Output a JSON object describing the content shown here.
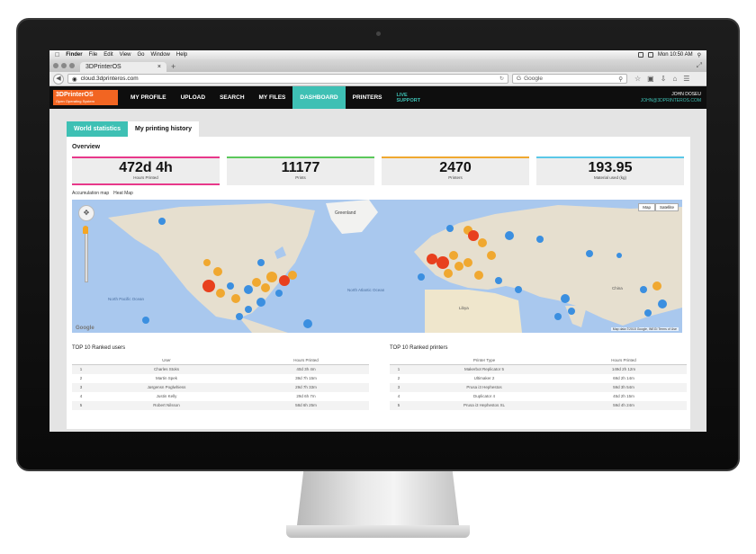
{
  "mac_menubar": {
    "items": [
      "Finder",
      "File",
      "Edit",
      "View",
      "Go",
      "Window",
      "Help"
    ],
    "clock": "Mon 10:50 AM"
  },
  "browser": {
    "tab_title": "3DPrinterOS",
    "url": "cloud.3dprinteros.com",
    "search_placeholder": "Google",
    "search_engine": "G"
  },
  "app_nav": {
    "logo_text": "3DPrinterOS",
    "logo_subtitle": "Open Operating System",
    "items": [
      {
        "label": "MY PROFILE"
      },
      {
        "label": "UPLOAD"
      },
      {
        "label": "SEARCH"
      },
      {
        "label": "MY FILES"
      },
      {
        "label": "DASHBOARD"
      },
      {
        "label": "PRINTERS"
      }
    ],
    "live_support_line1": "LIVE",
    "live_support_line2": "SUPPORT",
    "user_name": "JOHN DOSEU",
    "user_email": "JOHN@3DPRINTEROS.COM"
  },
  "page_tabs": [
    "World statistics",
    "My printing history"
  ],
  "overview": {
    "title": "Overview",
    "stats": [
      {
        "value": "472d 4h",
        "label": "Hours Printed",
        "color": "#e8388a"
      },
      {
        "value": "11177",
        "label": "Prints",
        "color": "#5bc85b"
      },
      {
        "value": "2470",
        "label": "Printers",
        "color": "#f0a830"
      },
      {
        "value": "193.95",
        "label": "Material used (kg)",
        "color": "#5bc8e8"
      }
    ]
  },
  "map": {
    "links": [
      "Accumulation map",
      "Heat Map"
    ],
    "type_buttons": [
      "Map",
      "Satellite"
    ],
    "brand": "Google",
    "copyright": "Map data ©2015 Google, INEGI   Terms of Use",
    "labels": {
      "greenland": "Greenland",
      "north_atlantic_ocean": "North Atlantic Ocean",
      "north_pacific_ocean": "North Pacific Ocean",
      "libya": "Libya",
      "china": "China"
    }
  },
  "top_users": {
    "title": "TOP 10 Ranked users",
    "columns": [
      "",
      "User",
      "Hours Printed"
    ],
    "rows": [
      {
        "rank": "1",
        "name": "Charles Stoks",
        "value": "40d 3h 4m"
      },
      {
        "rank": "2",
        "name": "Martin Spek",
        "value": "39d 7h 15m"
      },
      {
        "rank": "3",
        "name": "Jørgensn Poglwhiess",
        "value": "29d 7h 33m"
      },
      {
        "rank": "4",
        "name": "Justin Kelly",
        "value": "29d 6h 7m"
      },
      {
        "rank": "5",
        "name": "Robert Nilsson",
        "value": "58d 6h 25m"
      }
    ]
  },
  "top_printers": {
    "title": "TOP 10 Ranked printers",
    "columns": [
      "",
      "Printer Type",
      "Hours Printed"
    ],
    "rows": [
      {
        "rank": "1",
        "name": "Makerbot Replicator 5",
        "value": "149d 2h 12m"
      },
      {
        "rank": "2",
        "name": "Ultimaker 2",
        "value": "69d 2h 14m"
      },
      {
        "rank": "3",
        "name": "Prusa i3 Hephestos",
        "value": "59d 3h 54m"
      },
      {
        "rank": "4",
        "name": "Duplicator 4",
        "value": "45d 2h 15m"
      },
      {
        "rank": "5",
        "name": "Prusa i3 Hephestos XL",
        "value": "59d 4h 24m"
      }
    ]
  },
  "chat_icon": "chat-bubble-icon"
}
